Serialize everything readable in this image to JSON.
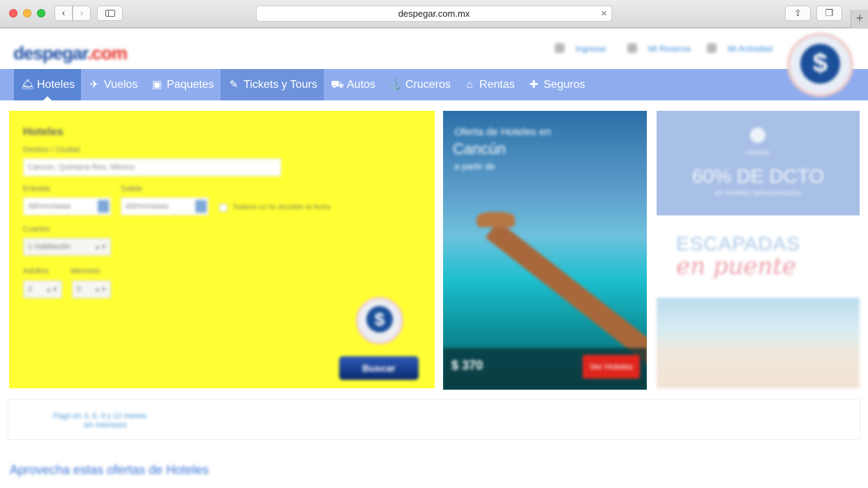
{
  "browser": {
    "url": "despegar.com.mx",
    "back_glyph": "‹",
    "forward_glyph": "›",
    "clear_glyph": "×",
    "share_glyph": "⇪",
    "tabs_glyph": "❐",
    "newtab_glyph": "+"
  },
  "header": {
    "logo_main": "despegar",
    "logo_dotcom": ".com",
    "links": [
      "Ingresar",
      "Mi Reserva",
      "Mi Actividad"
    ]
  },
  "nav": {
    "items": [
      {
        "label": "Hoteles",
        "icon": "bell-icon"
      },
      {
        "label": "Vuelos",
        "icon": "plane-icon"
      },
      {
        "label": "Paquetes",
        "icon": "suitcase-icon"
      },
      {
        "label": "Tickets y Tours",
        "icon": "ticket-icon"
      },
      {
        "label": "Autos",
        "icon": "car-icon"
      },
      {
        "label": "Cruceros",
        "icon": "ship-icon"
      },
      {
        "label": "Rentas",
        "icon": "house-icon"
      },
      {
        "label": "Seguros",
        "icon": "medkit-icon"
      }
    ]
  },
  "search": {
    "title": "Hoteles",
    "destination_label": "Destino / Ciudad",
    "destination_value": "Cancún, Quintana Roo, México",
    "checkin_label": "Entrada",
    "checkin_placeholder": "dd/mm/aaaa",
    "checkout_label": "Salida",
    "checkout_placeholder": "dd/mm/aaaa",
    "no_dates_label": "Todavía no he decidido la fecha",
    "rooms_label": "Cuartos",
    "rooms_value": "1 Habitación",
    "adults_label": "Adultos",
    "adults_value": "2",
    "minors_label": "Menores",
    "minors_value": "0",
    "badge_symbol": "$",
    "submit_label": "Buscar"
  },
  "promos": {
    "cancun": {
      "line1": "Oferta de Hoteles en",
      "line2": "Cancún",
      "line3": "a partir de",
      "price": "$ 370",
      "cta": "Ver Hoteles"
    },
    "discount": {
      "subtitle": "Hoteles",
      "headline": "60% DE DCTO",
      "detail": "en hoteles seleccionados"
    },
    "escapadas": {
      "title": "ESCAPADAS",
      "subtitle": "en puente"
    }
  },
  "pagination": {
    "line1": "Pago en 3, 6, 9 y 12 meses",
    "line2": "sin intereses"
  },
  "offers_title": "Aprovecha estas ofertas de Hoteles",
  "corner_badge_symbol": "$"
}
